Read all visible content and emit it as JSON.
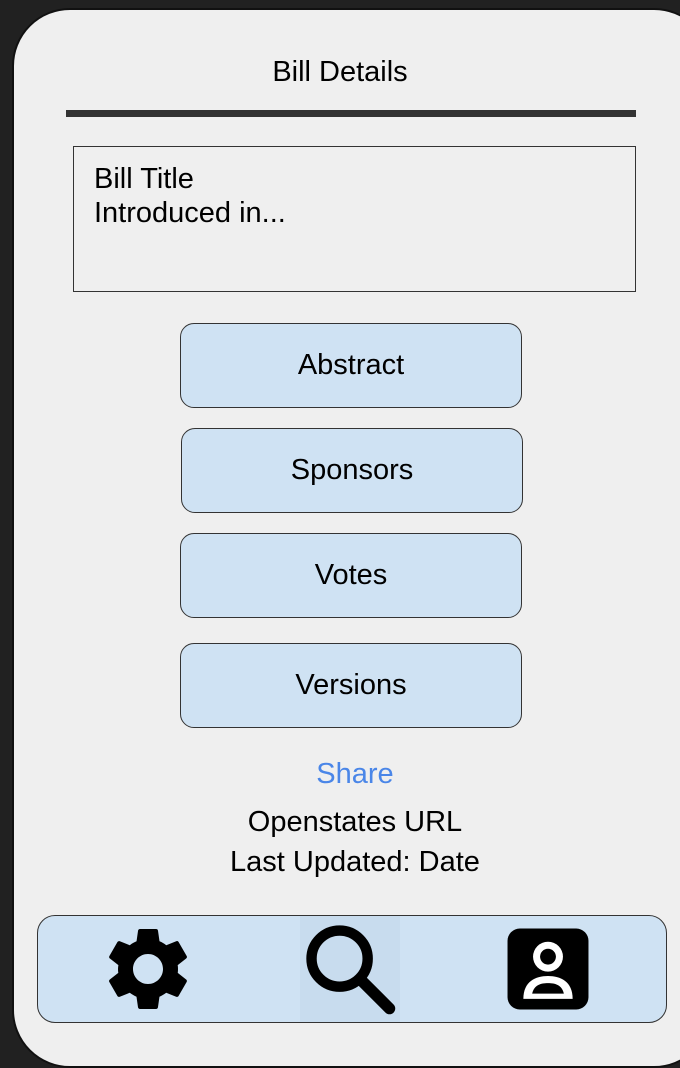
{
  "header": {
    "title": "Bill Details"
  },
  "bill_info": {
    "title": "Bill Title",
    "introduced": "Introduced in..."
  },
  "sections": {
    "abstract": "Abstract",
    "sponsors": "Sponsors",
    "votes": "Votes",
    "versions": "Versions"
  },
  "footer": {
    "share": "Share",
    "url": "Openstates URL",
    "last_updated": "Last Updated: Date"
  },
  "tab_bar": {
    "icons": [
      "gear-icon",
      "search-icon",
      "user-profile-icon"
    ]
  },
  "colors": {
    "button_fill": "#cfe2f3",
    "link": "#4a86e8",
    "screen_bg": "#efefef",
    "outer_bg": "#212121"
  }
}
